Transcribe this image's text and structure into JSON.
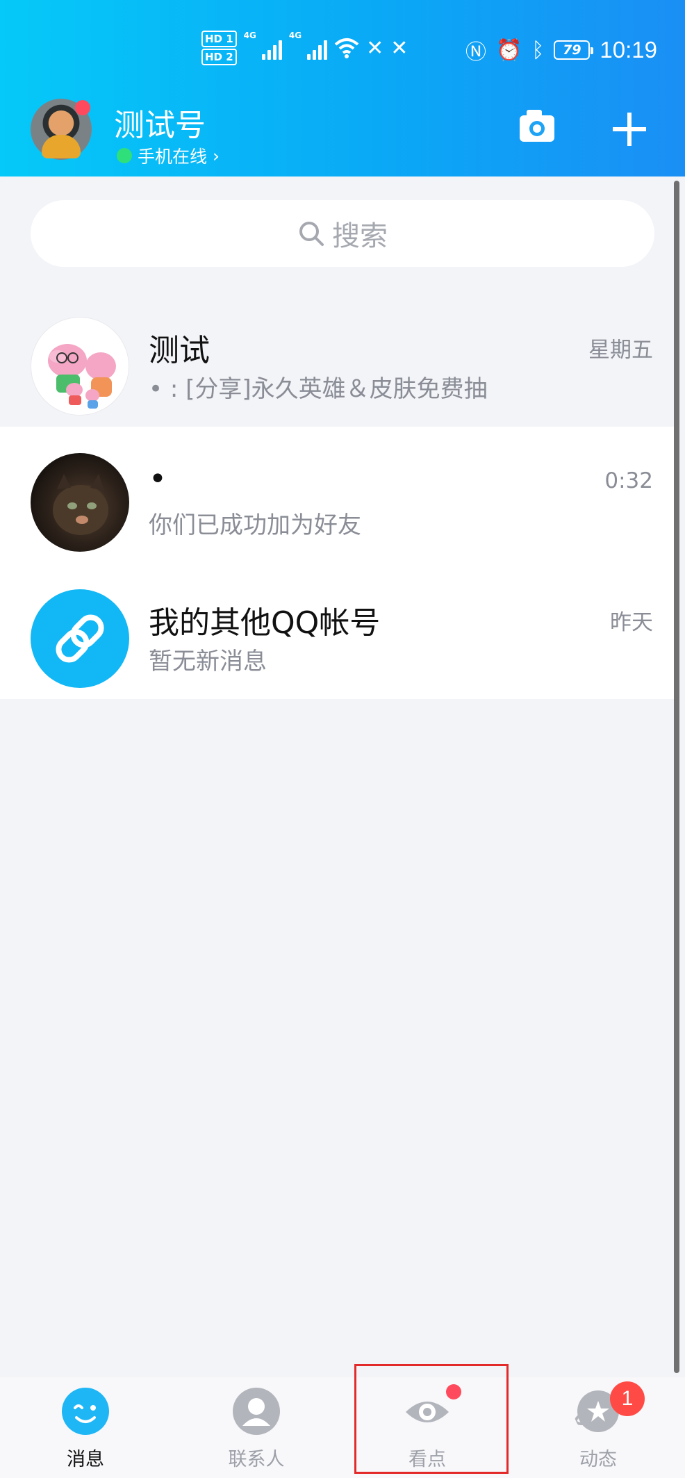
{
  "status_bar": {
    "hd1": "HD 1",
    "hd2": "HD 2",
    "net1": "4G",
    "net2": "4G",
    "battery": "79",
    "time": "10:19"
  },
  "header": {
    "profile_name": "测试号",
    "online_status": "手机在线",
    "online_chevron": "›"
  },
  "search": {
    "placeholder": "搜索"
  },
  "conversations": [
    {
      "title": "测试",
      "preview": "• : [分享]永久英雄＆皮肤免费抽",
      "time": "星期五",
      "pinned": true
    },
    {
      "title": "•",
      "preview": "你们已成功加为好友",
      "time": "0:32",
      "pinned": false
    },
    {
      "title": "我的其他QQ帐号",
      "preview": "暂无新消息",
      "time": "昨天",
      "pinned": false
    }
  ],
  "tabs": [
    {
      "label": "消息",
      "active": true
    },
    {
      "label": "联系人",
      "active": false
    },
    {
      "label": "看点",
      "active": false
    },
    {
      "label": "动态",
      "active": false,
      "badge": "1"
    }
  ],
  "colors": {
    "header_start": "#05c9f8",
    "header_end": "#1a8ff5",
    "accent": "#12b7f5",
    "badge": "#ff4a45",
    "online": "#2fe07a",
    "highlight": "#e32a2a"
  },
  "icons": [
    "camera-icon",
    "plus-icon",
    "search-icon",
    "link-icon",
    "message-icon",
    "contacts-icon",
    "eye-icon",
    "star-planet-icon"
  ]
}
